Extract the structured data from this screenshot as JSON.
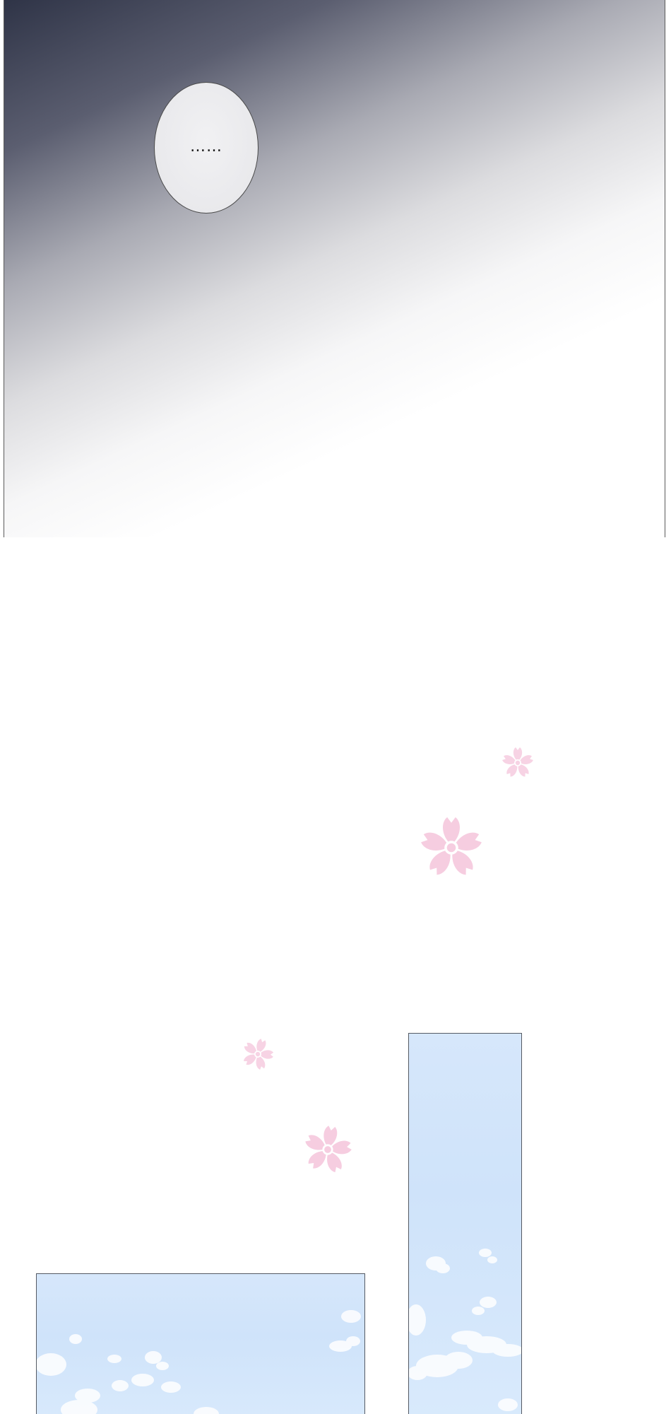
{
  "speech_bubble": {
    "text": "……"
  },
  "colors": {
    "gradient_dark": "#2f3447",
    "bubble_fill": "#ebebee",
    "flower_pink": "#f6cfe2",
    "sky_blue": "#d4e6fb",
    "panel_border": "#555a63"
  },
  "icons": {
    "flower": "sakura-flower-icon",
    "cloud": "cloud-icon"
  }
}
